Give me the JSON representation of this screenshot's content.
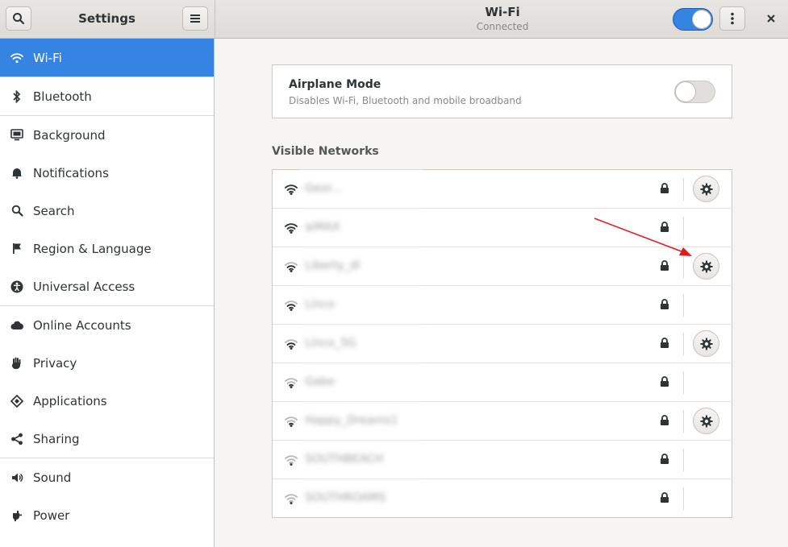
{
  "header": {
    "app_title": "Settings",
    "panel_title": "Wi-Fi",
    "panel_status": "Connected",
    "wifi_enabled": true
  },
  "sidebar": {
    "items": [
      {
        "label": "Wi-Fi",
        "icon": "wifi-icon",
        "active": true
      },
      {
        "label": "Bluetooth",
        "icon": "bluetooth-icon"
      },
      {
        "label": "Background",
        "icon": "background-icon"
      },
      {
        "label": "Notifications",
        "icon": "bell-icon"
      },
      {
        "label": "Search",
        "icon": "search-icon"
      },
      {
        "label": "Region & Language",
        "icon": "flag-icon"
      },
      {
        "label": "Universal Access",
        "icon": "accessibility-icon"
      },
      {
        "label": "Online Accounts",
        "icon": "cloud-icon"
      },
      {
        "label": "Privacy",
        "icon": "hand-icon"
      },
      {
        "label": "Applications",
        "icon": "applications-icon"
      },
      {
        "label": "Sharing",
        "icon": "share-icon"
      },
      {
        "label": "Sound",
        "icon": "speaker-icon"
      },
      {
        "label": "Power",
        "icon": "power-icon"
      }
    ]
  },
  "airplane": {
    "title": "Airplane Mode",
    "description": "Disables Wi-Fi, Bluetooth and mobile broadband",
    "enabled": false
  },
  "networks": {
    "heading": "Visible Networks",
    "items": [
      {
        "name": "Geor...",
        "signal": 4,
        "secured": true,
        "has_settings": true
      },
      {
        "name": "aiMAX",
        "signal": 4,
        "secured": true,
        "has_settings": false
      },
      {
        "name": "Liberty_dl",
        "signal": 3,
        "secured": true,
        "has_settings": true
      },
      {
        "name": "Linco",
        "signal": 3,
        "secured": true,
        "has_settings": false
      },
      {
        "name": "Linco_5G",
        "signal": 3,
        "secured": true,
        "has_settings": true
      },
      {
        "name": "Gabe",
        "signal": 2,
        "secured": true,
        "has_settings": false
      },
      {
        "name": "Happy_Dreams1",
        "signal": 2,
        "secured": true,
        "has_settings": true
      },
      {
        "name": "SOUTHBEACH",
        "signal": 1,
        "secured": true,
        "has_settings": false
      },
      {
        "name": "SOUTHROAMS",
        "signal": 1,
        "secured": true,
        "has_settings": false
      }
    ]
  },
  "colors": {
    "accent": "#3584e4",
    "annotation_arrow": "#e01b1b"
  }
}
